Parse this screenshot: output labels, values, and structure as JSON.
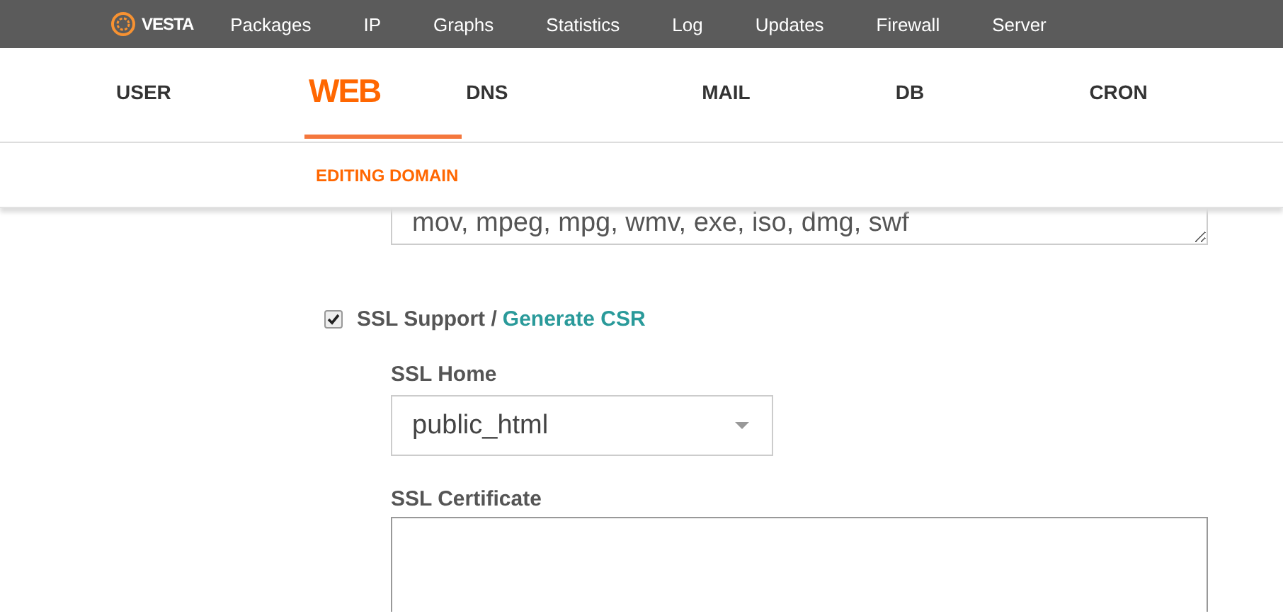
{
  "top_nav": {
    "logo": "VESTA",
    "items": [
      "Packages",
      "IP",
      "Graphs",
      "Statistics",
      "Log",
      "Updates",
      "Firewall",
      "Server"
    ]
  },
  "tabs": [
    {
      "label": "USER",
      "selected": false
    },
    {
      "label": "WEB",
      "selected": true
    },
    {
      "label": "DNS",
      "selected": false
    },
    {
      "label": "MAIL",
      "selected": false
    },
    {
      "label": "DB",
      "selected": false
    },
    {
      "label": "CRON",
      "selected": false
    }
  ],
  "subheader": "EDITING DOMAIN",
  "extensions_field": {
    "value": "mov, mpeg, mpg, wmv, exe, iso, dmg, swf"
  },
  "ssl": {
    "checked": true,
    "label": "SSL Support /",
    "link": "Generate CSR"
  },
  "ssl_home": {
    "label": "SSL Home",
    "value": "public_html"
  },
  "ssl_certificate": {
    "label": "SSL Certificate"
  }
}
